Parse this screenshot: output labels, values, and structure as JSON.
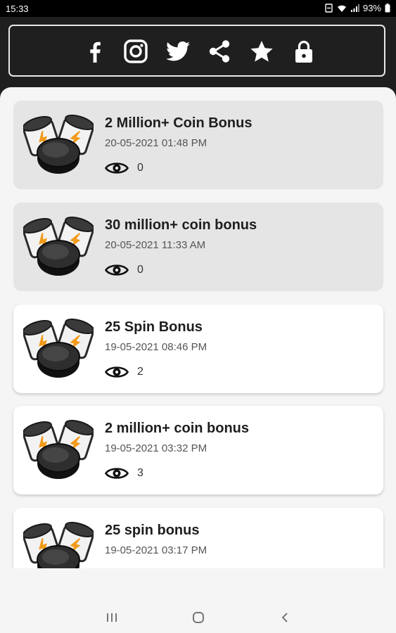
{
  "status_bar": {
    "time": "15:33",
    "battery": "93%"
  },
  "header": {
    "social_icons": [
      "facebook-icon",
      "instagram-icon",
      "twitter-icon",
      "share-icon",
      "star-icon",
      "lock-icon"
    ]
  },
  "colors": {
    "header_bg": "#1f1f1f",
    "content_bg": "#f5f5f5",
    "read_card_bg": "#e5e5e5",
    "unread_card_bg": "#ffffff",
    "bolt_accent": "#f29a1b"
  },
  "rewards": [
    {
      "title": "2 Million+ Coin Bonus",
      "date": "20-05-2021 01:48 PM",
      "views": "0",
      "read": true
    },
    {
      "title": "30 million+ coin bonus",
      "date": "20-05-2021 11:33 AM",
      "views": "0",
      "read": true
    },
    {
      "title": "25 Spin Bonus",
      "date": "19-05-2021 08:46 PM",
      "views": "2",
      "read": false
    },
    {
      "title": "2 million+ coin bonus",
      "date": "19-05-2021 03:32 PM",
      "views": "3",
      "read": false
    },
    {
      "title": "25 spin bonus",
      "date": "19-05-2021 03:17 PM",
      "views": "",
      "read": false
    }
  ],
  "nav_bar": {
    "buttons": [
      "recent-apps-icon",
      "home-icon",
      "back-icon"
    ]
  }
}
